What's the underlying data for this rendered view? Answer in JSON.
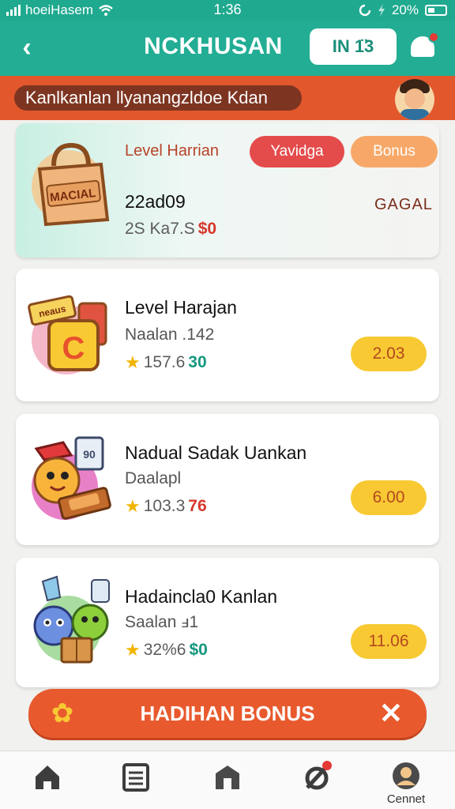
{
  "status_bar": {
    "carrier": "hoeiHasem",
    "time": "1:36",
    "battery": "20%"
  },
  "header": {
    "title": "NCKHUSAN",
    "in_button": "IN 1̈3"
  },
  "banner": {
    "text": "Kanlkanlan llyanangzldoe Kdan"
  },
  "featured": {
    "title": "Level Harrian",
    "pill_red": "Yavidga",
    "pill_orange": "Bonus",
    "code": "22ad09",
    "meta_num": "2S Ka7.S",
    "meta_value": "$0",
    "status": "GAGAL",
    "bag_label": "MACIAL"
  },
  "items": [
    {
      "title": "Level Harajan",
      "subtitle": "Naalan .142",
      "rating": "157.6",
      "value": "30",
      "amount": "2.03",
      "icon_label": "neaus",
      "icon_letter": "C"
    },
    {
      "title": "Nadual Sadak Uankan",
      "subtitle": "Daalapl",
      "rating": "103.3",
      "value": "76",
      "amount": "6.00",
      "icon_label": "90"
    },
    {
      "title": "Hadaincla0 Kanlan",
      "subtitle": "Saalan ⅎ1",
      "rating": "32%6",
      "value": "$0",
      "amount": "11.06"
    }
  ],
  "bonus_bar": {
    "label": "HADIHAN BONUS"
  },
  "bottom_nav": {
    "profile_label": "Cennet"
  },
  "colors": {
    "header": "#22ad94",
    "banner": "#e2582c",
    "amount_button": "#f8c933",
    "bonus_bar": "#e85a2e"
  }
}
